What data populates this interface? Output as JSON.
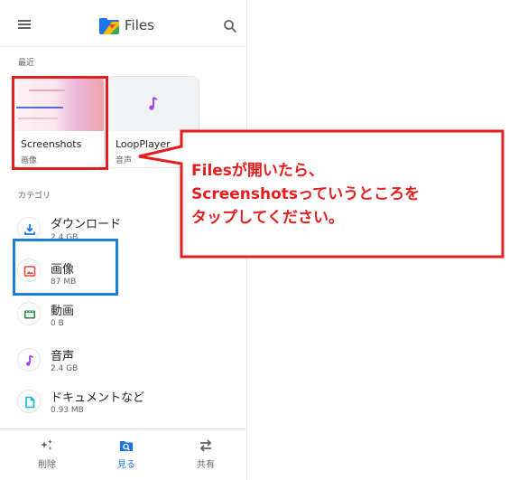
{
  "app": {
    "title": "Files",
    "logo_icon": "files-logo-icon",
    "menu_icon": "hamburger-menu-icon",
    "search_icon": "search-icon"
  },
  "recent": {
    "label": "最近",
    "items": [
      {
        "name": "Screenshots",
        "sub": "画像",
        "thumb_lines": [
          "「読み書きして全部能力」",
          "How to read in my Kitchen"
        ]
      },
      {
        "name": "LoopPlayer",
        "sub": "音声",
        "icon": "music-note-icon"
      }
    ]
  },
  "categories": {
    "label": "カテゴリ",
    "items": [
      {
        "name": "ダウンロード",
        "size": "2.4 GB",
        "icon": "download-icon",
        "color": "#1a73e8"
      },
      {
        "name": "画像",
        "size": "87 MB",
        "icon": "image-icon",
        "color": "#e8453c"
      },
      {
        "name": "動画",
        "size": "0 B",
        "icon": "video-icon",
        "color": "#1e8e3e"
      },
      {
        "name": "音声",
        "size": "2.4 GB",
        "icon": "audio-icon",
        "color": "#a142f4"
      },
      {
        "name": "ドキュメントなど",
        "size": "0.93 MB",
        "icon": "document-icon",
        "color": "#12b5cb"
      }
    ]
  },
  "bottom_nav": {
    "items": [
      {
        "label": "削除",
        "icon": "sparkle-clean-icon",
        "active": false
      },
      {
        "label": "見る",
        "icon": "browse-icon",
        "active": true
      },
      {
        "label": "共有",
        "icon": "share-arrows-icon",
        "active": false
      }
    ]
  },
  "annotation": {
    "lines": [
      "Filesが開いたら、",
      "Screenshotsっていうところを",
      "タップしてください。"
    ],
    "color": "#e41e1e",
    "highlight_colors": {
      "screenshots": "#e41e1e",
      "images": "#1e7dd6"
    }
  }
}
